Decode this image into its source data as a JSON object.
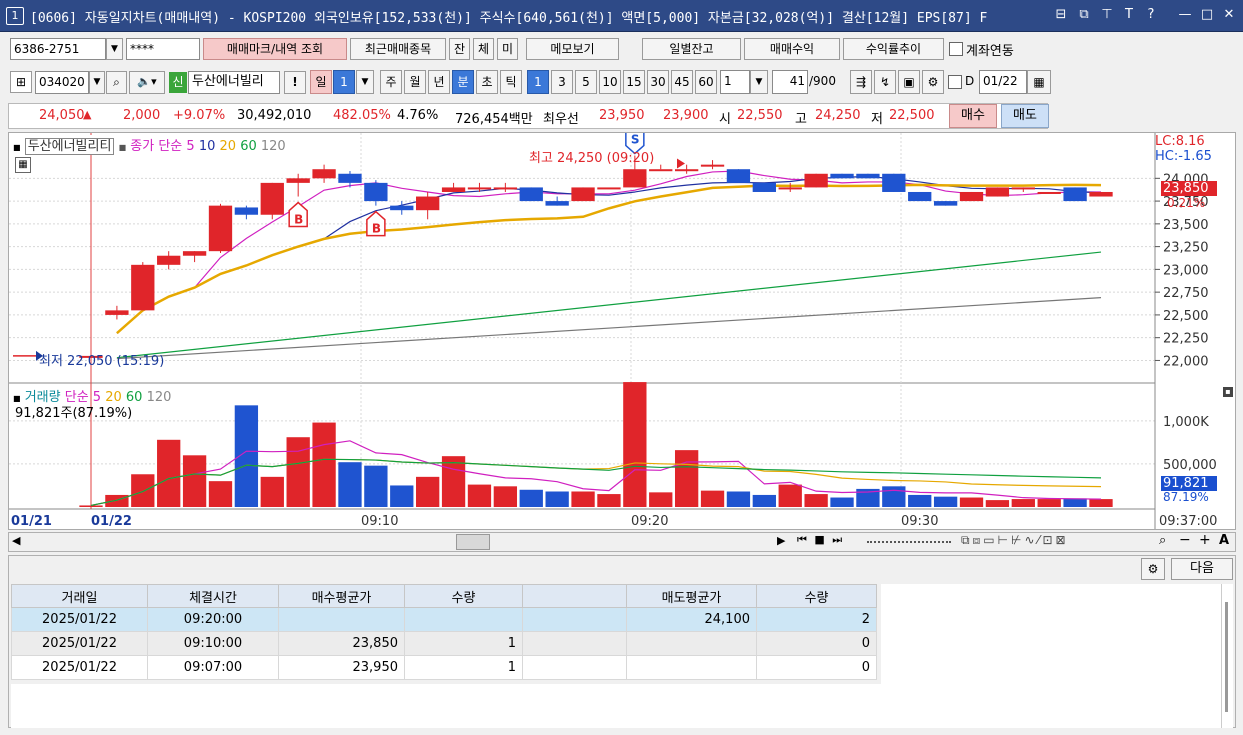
{
  "window": {
    "number": "1",
    "title": "[0606] 자동일지차트(매매내역) - KOSPI200 외국인보유[152,533(천)] 주식수[640,561(천)] 액면[5,000] 자본금[32,028(억)] 결산[12월] EPS[87] F"
  },
  "account": {
    "number": "6386-2751",
    "password": "****",
    "link_label": "계좌연동"
  },
  "toolbar1": {
    "trade_mark": "매매마크/내역 조회",
    "recent_trades": "최근매매종목",
    "tab_jan": "잔",
    "tab_che": "체",
    "tab_mi": "미",
    "memo": "메모보기",
    "daily_balance": "일별잔고",
    "trade_profit": "매매수익",
    "return_trend": "수익률추이"
  },
  "toolbar2": {
    "code": "034020",
    "credit_badge": "신",
    "stock_name": "두산에너빌리",
    "alert": "!",
    "period_day": "일",
    "period_num": "1",
    "period_week": "주",
    "period_month": "월",
    "period_year": "년",
    "period_min": "분",
    "period_sec": "초",
    "period_tick": "틱",
    "min_options": [
      "1",
      "3",
      "5",
      "10",
      "15",
      "30",
      "45",
      "60"
    ],
    "interval": "1",
    "count": "41",
    "count_max": "/900",
    "date_checkbox": "D",
    "date": "01/22"
  },
  "pricebar": {
    "price": "24,050",
    "arrow": "▲",
    "change": "2,000",
    "pct": "+9.07%",
    "volume": "30,492,010",
    "vol_ratio": "482.05%",
    "turnover": "4.76%",
    "amount": "726,454백만",
    "best_label": "최우선",
    "ask": "23,950",
    "bid": "23,900",
    "open_label": "시",
    "open": "22,550",
    "high_label": "고",
    "high": "24,250",
    "low_label": "저",
    "low": "22,500",
    "buy": "매수",
    "sell": "매도"
  },
  "chart_legend": {
    "stock": "두산에너빌리티",
    "close_label": "종가 단순",
    "ma5": "5",
    "ma10": "10",
    "ma20": "20",
    "ma60": "60",
    "ma120": "120",
    "lc": "LC:8.16",
    "hc": "HC:-1.65",
    "high_note": "최고 24,250 (09:20)",
    "low_note": "최저 22,050 (15:19)",
    "cur_price": "23,850",
    "cur_pct": "0.21%",
    "vol_label": "거래량",
    "vol_ma": "단순",
    "vol_text": "91,821주(87.19%)",
    "vol_cur": "91,821",
    "vol_pct": "87.19%"
  },
  "chart_data": {
    "type": "candlestick",
    "price_axis": {
      "ticks": [
        "24,000",
        "23,750",
        "23,500",
        "23,250",
        "23,000",
        "22,750",
        "22,500",
        "22,250",
        "22,000"
      ],
      "range": [
        21950,
        24300
      ]
    },
    "volume_axis": {
      "ticks": [
        "1,000K",
        "500,000"
      ],
      "range": [
        0,
        1300000
      ]
    },
    "time_labels": [
      "01/21",
      "01/22",
      "09:10",
      "09:20",
      "09:30",
      "09:37:00"
    ],
    "candles": [
      {
        "o": 22050,
        "h": 22050,
        "l": 22050,
        "c": 22050
      },
      {
        "o": 22500,
        "h": 22600,
        "l": 22450,
        "c": 22550
      },
      {
        "o": 22550,
        "h": 23080,
        "l": 22550,
        "c": 23050
      },
      {
        "o": 23050,
        "h": 23200,
        "l": 23000,
        "c": 23150
      },
      {
        "o": 23150,
        "h": 23200,
        "l": 23080,
        "c": 23200
      },
      {
        "o": 23200,
        "h": 23720,
        "l": 23180,
        "c": 23700
      },
      {
        "o": 23680,
        "h": 23700,
        "l": 23550,
        "c": 23600
      },
      {
        "o": 23600,
        "h": 23950,
        "l": 23550,
        "c": 23950
      },
      {
        "o": 23950,
        "h": 24050,
        "l": 23800,
        "c": 24000
      },
      {
        "o": 24000,
        "h": 24150,
        "l": 23950,
        "c": 24100
      },
      {
        "o": 24050,
        "h": 24080,
        "l": 23900,
        "c": 23950
      },
      {
        "o": 23950,
        "h": 23980,
        "l": 23700,
        "c": 23750
      },
      {
        "o": 23700,
        "h": 23750,
        "l": 23600,
        "c": 23650
      },
      {
        "o": 23650,
        "h": 23850,
        "l": 23550,
        "c": 23800
      },
      {
        "o": 23850,
        "h": 23950,
        "l": 23850,
        "c": 23900
      },
      {
        "o": 23900,
        "h": 23950,
        "l": 23850,
        "c": 23900
      },
      {
        "o": 23900,
        "h": 23950,
        "l": 23850,
        "c": 23900
      },
      {
        "o": 23900,
        "h": 23900,
        "l": 23750,
        "c": 23750
      },
      {
        "o": 23750,
        "h": 23800,
        "l": 23700,
        "c": 23700
      },
      {
        "o": 23750,
        "h": 23900,
        "l": 23750,
        "c": 23900
      },
      {
        "o": 23900,
        "h": 23900,
        "l": 23900,
        "c": 23900
      },
      {
        "o": 23900,
        "h": 24250,
        "l": 23900,
        "c": 24100
      },
      {
        "o": 24100,
        "h": 24150,
        "l": 24100,
        "c": 24100
      },
      {
        "o": 24100,
        "h": 24150,
        "l": 24050,
        "c": 24100
      },
      {
        "o": 24150,
        "h": 24200,
        "l": 24100,
        "c": 24150
      },
      {
        "o": 24100,
        "h": 24100,
        "l": 23950,
        "c": 23950
      },
      {
        "o": 23950,
        "h": 23950,
        "l": 23850,
        "c": 23850
      },
      {
        "o": 23900,
        "h": 23950,
        "l": 23850,
        "c": 23900
      },
      {
        "o": 23900,
        "h": 24050,
        "l": 23900,
        "c": 24050
      },
      {
        "o": 24050,
        "h": 24050,
        "l": 24000,
        "c": 24000
      },
      {
        "o": 24050,
        "h": 24050,
        "l": 24000,
        "c": 24000
      },
      {
        "o": 24050,
        "h": 24050,
        "l": 23850,
        "c": 23850
      },
      {
        "o": 23850,
        "h": 23850,
        "l": 23750,
        "c": 23750
      },
      {
        "o": 23750,
        "h": 23750,
        "l": 23700,
        "c": 23700
      },
      {
        "o": 23750,
        "h": 23850,
        "l": 23750,
        "c": 23850
      },
      {
        "o": 23800,
        "h": 23900,
        "l": 23800,
        "c": 23900
      },
      {
        "o": 23900,
        "h": 23900,
        "l": 23850,
        "c": 23900
      },
      {
        "o": 23850,
        "h": 23850,
        "l": 23850,
        "c": 23850
      },
      {
        "o": 23900,
        "h": 23900,
        "l": 23750,
        "c": 23750
      },
      {
        "o": 23800,
        "h": 23850,
        "l": 23800,
        "c": 23850
      }
    ],
    "volumes": [
      18000,
      140000,
      380000,
      780000,
      600000,
      300000,
      1180000,
      350000,
      810000,
      980000,
      520000,
      480000,
      250000,
      350000,
      590000,
      260000,
      240000,
      200000,
      180000,
      180000,
      150000,
      1450000,
      170000,
      660000,
      190000,
      180000,
      140000,
      260000,
      150000,
      110000,
      210000,
      240000,
      140000,
      120000,
      110000,
      80000,
      92000,
      92000,
      100000,
      91821
    ],
    "markers": [
      {
        "type": "B",
        "index": 8
      },
      {
        "type": "B",
        "index": 11
      },
      {
        "type": "S",
        "index": 21
      }
    ]
  },
  "scroll": {
    "tools": "▸|◂◂ ■ ▸▸"
  },
  "table": {
    "headers": [
      "거래일",
      "체결시간",
      "매수평균가",
      "수량",
      "",
      "매도평균가",
      "수량"
    ],
    "rows": [
      [
        "2025/01/22",
        "09:20:00",
        "",
        "",
        "",
        "24,100",
        "2"
      ],
      [
        "2025/01/22",
        "09:10:00",
        "23,850",
        "1",
        "",
        "",
        "0"
      ],
      [
        "2025/01/22",
        "09:07:00",
        "23,950",
        "1",
        "",
        "",
        "0"
      ]
    ],
    "next_label": "다음"
  }
}
